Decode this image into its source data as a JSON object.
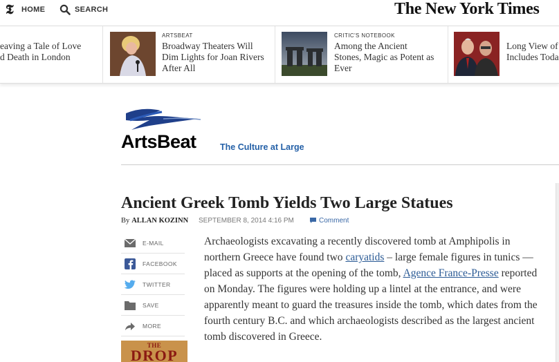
{
  "topbar": {
    "logo_glyph": "𝕿",
    "home_label": "HOME",
    "search_label": "SEARCH",
    "masthead": "The New York Times"
  },
  "ribbon": [
    {
      "kicker": "",
      "headline": "eaving a Tale of Love\nd Death in London",
      "thumb": "none"
    },
    {
      "kicker": "ARTSBEAT",
      "headline": "Broadway Theaters Will\nDim Lights for Joan Rivers\nAfter All",
      "thumb": "performer"
    },
    {
      "kicker": "CRITIC'S NOTEBOOK",
      "headline": "Among the Ancient\nStones, Magic as Potent as\nEver",
      "thumb": "stonehenge"
    },
    {
      "kicker": "",
      "headline": "Long View of\nIncludes Toda",
      "thumb": "two-men"
    }
  ],
  "blog": {
    "name": "ArtsBeat",
    "tagline": "The Culture at Large"
  },
  "article": {
    "headline": "Ancient Greek Tomb Yields Two Large Statues",
    "by": "By",
    "author": "ALLAN KOZINN",
    "date": "SEPTEMBER 8, 2014 4:16 PM",
    "comment_label": "Comment",
    "body_1": "Archaeologists excavating a recently discovered tomb at Amphipolis in northern Greece have found two ",
    "link_1": "caryatids",
    "body_2": " – large female figures in tunics — placed as supports at the opening of the tomb, ",
    "link_2": "Agence France-Presse",
    "body_3": " reported on Monday. The figures were holding up a lintel at the entrance, and were apparently meant to guard the treasures inside the tomb, which dates from the fourth century B.C. and which archaeologists described as the largest ancient tomb discovered in Greece."
  },
  "share": [
    {
      "label": "E-MAIL",
      "icon": "email-icon"
    },
    {
      "label": "FACEBOOK",
      "icon": "facebook-icon"
    },
    {
      "label": "TWITTER",
      "icon": "twitter-icon"
    },
    {
      "label": "SAVE",
      "icon": "save-icon"
    },
    {
      "label": "MORE",
      "icon": "more-arrow-icon"
    }
  ],
  "promo": {
    "the": "THE",
    "word": "DROP"
  },
  "colors": {
    "link": "#2a5a95",
    "tagline": "#2460a7",
    "twitter": "#55acee",
    "facebook": "#3b5998"
  }
}
